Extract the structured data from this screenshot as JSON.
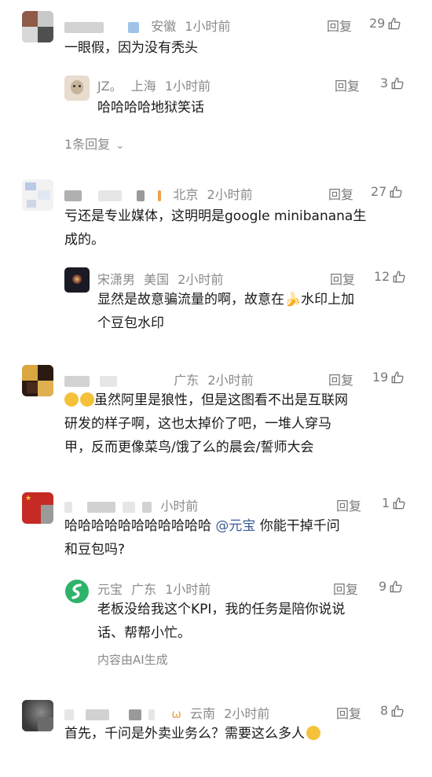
{
  "c1": {
    "loc": "安徽",
    "time": "1小时前",
    "reply": "回复",
    "likes": "29",
    "text": "一眼假，因为没有秃头"
  },
  "c1r1": {
    "name": "JZ。",
    "loc": "上海",
    "time": "1小时前",
    "reply": "回复",
    "likes": "3",
    "text": "哈哈哈哈地狱笑话"
  },
  "c1_expand": "1条回复",
  "c2": {
    "loc": "北京",
    "time": "2小时前",
    "reply": "回复",
    "likes": "27",
    "line1": "亏还是专业媒体，这明明是google minibanana生",
    "line2": "成的。"
  },
  "c2r1": {
    "name": "宋潇男",
    "loc": "美国",
    "time": "2小时前",
    "reply": "回复",
    "likes": "12",
    "line1a": "显然是故意骗流量的啊，故意在",
    "line1b": "水印上加",
    "line2": "个豆包水印"
  },
  "c3": {
    "loc": "广东",
    "time": "2小时前",
    "reply": "回复",
    "likes": "19",
    "line1": "虽然阿里是狼性，但是这图看不出是互联网",
    "line2": "研发的样子啊，这也太掉价了吧，一堆人穿马",
    "line3": "甲，反而更像菜鸟/饿了么的晨会/誓师大会"
  },
  "c4": {
    "time": "小时前",
    "reply": "回复",
    "likes": "1",
    "line1a": "哈哈哈哈哈哈哈哈哈哈哈 ",
    "mention": "@元宝",
    "line1b": " 你能干掉千问",
    "line2": "和豆包吗?"
  },
  "c4r1": {
    "name": "元宝",
    "loc": "广东",
    "time": "1小时前",
    "reply": "回复",
    "likes": "9",
    "line1": "老板没给我这个KPI，我的任务是陪你说说",
    "line2": "话、帮帮小忙。",
    "ai_note": "内容由AI生成"
  },
  "c5": {
    "loc": "云南",
    "time": "2小时前",
    "reply": "回复",
    "likes": "8",
    "text": "首先，千问是外卖业务么？需要这么多人"
  },
  "colors": {
    "text": "#1a1a1a",
    "meta": "#8a8a8a",
    "mention": "#3b5c9a",
    "yuanbao": "#2fb36a"
  }
}
